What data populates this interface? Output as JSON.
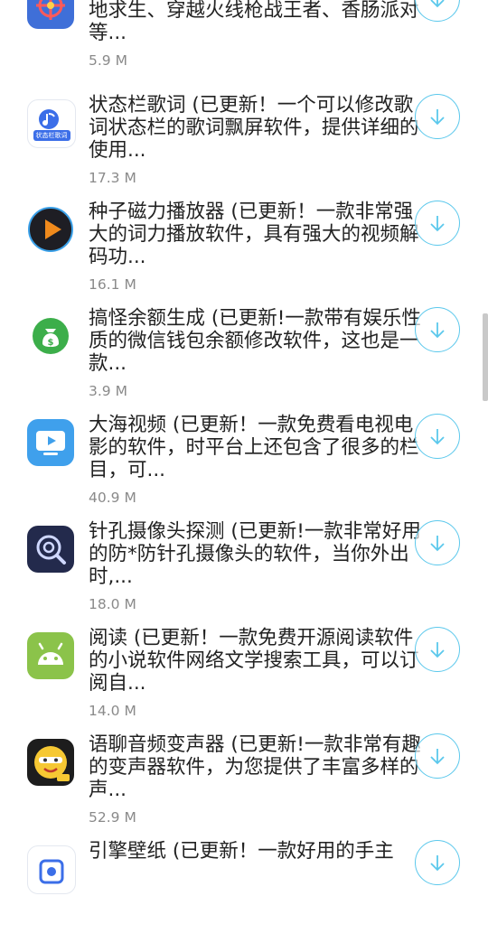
{
  "apps": [
    {
      "description": "准星精灵 (已更新！支持和平精英、绝地求生、穿越火线枪战王者、香肠派对等...",
      "size": "5.9 M",
      "icon": "crosshair-icon"
    },
    {
      "description": "状态栏歌词 (已更新！一个可以修改歌词状态栏的歌词飘屏软件，提供详细的使用...",
      "size": "17.3 M",
      "icon": "music-note-icon",
      "icon_caption": "状态栏歌词"
    },
    {
      "description": "种子磁力播放器 (已更新！一款非常强大的词力播放软件，具有强大的视频解码功...",
      "size": "16.1 M",
      "icon": "play-icon"
    },
    {
      "description": "搞怪余额生成 (已更新!一款带有娱乐性质的微信钱包余额修改软件，这也是一款...",
      "size": "3.9 M",
      "icon": "money-bag-icon"
    },
    {
      "description": "大海视频 (已更新！一款免费看电视电影的软件，时平台上还包含了很多的栏目，可...",
      "size": "40.9 M",
      "icon": "tv-icon"
    },
    {
      "description": "针孔摄像头探测 (已更新!一款非常好用的防*防针孔摄像头的软件，当你外出时,...",
      "size": "18.0 M",
      "icon": "camera-detect-icon"
    },
    {
      "description": "阅读 (已更新！一款免费开源阅读软件的小说软件网络文学搜索工具，可以订阅自...",
      "size": "14.0 M",
      "icon": "android-icon"
    },
    {
      "description": "语聊音频变声器 (已更新!一款非常有趣的变声器软件，为您提供了丰富多样的声...",
      "size": "52.9 M",
      "icon": "face-icon"
    },
    {
      "description": "引擎壁纸 (已更新！一款好用的手主",
      "size": "",
      "icon": "wallpaper-icon"
    }
  ],
  "colors": {
    "accent": "#5bc8ec",
    "text": "#222222",
    "muted": "#8a8a8a"
  }
}
